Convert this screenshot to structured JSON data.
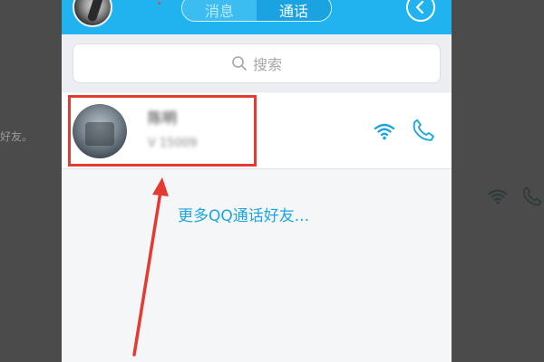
{
  "background": {
    "left_text": "好友。"
  },
  "header": {
    "tabs": [
      {
        "label": "消息"
      },
      {
        "label": "通话"
      }
    ]
  },
  "search": {
    "placeholder": "搜索"
  },
  "contact": {
    "name": "陈明",
    "sub": "V 15009"
  },
  "more_link": "更多QQ通话好友...",
  "colors": {
    "header_blue": "#21b3f0",
    "link_blue": "#1ba6e0",
    "highlight_red": "#e53a32"
  }
}
